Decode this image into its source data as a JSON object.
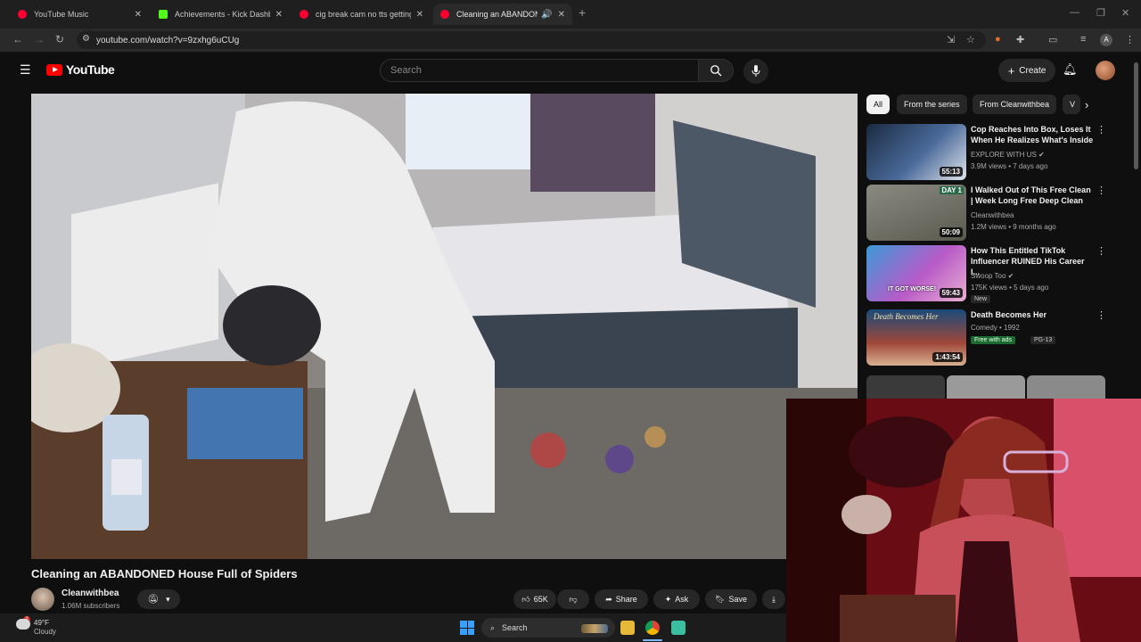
{
  "browser": {
    "tabs": [
      {
        "title": "YouTube Music",
        "active": false,
        "favicon_color": "#ff0033"
      },
      {
        "title": "Achievements - Kick Dashboard",
        "active": false,
        "favicon_color": "#53fc18"
      },
      {
        "title": "cig break cam no tts getting Ja",
        "active": false,
        "favicon_color": "#ff0033"
      },
      {
        "title": "Cleaning an ABANDONED H",
        "active": true,
        "favicon_color": "#ff0033"
      }
    ],
    "url": "youtube.com/watch?v=9zxhg6uCUg"
  },
  "youtube": {
    "logo_text": "YouTube",
    "search_placeholder": "Search",
    "create_label": "Create",
    "chips": [
      "All",
      "From the series",
      "From Cleanwithbea",
      "V"
    ],
    "recommendations": [
      {
        "title": "Cop Reaches Into Box, Loses It When He Realizes What's Inside",
        "channel": "EXPLORE WITH US",
        "verified": true,
        "meta": "3.9M views • 7 days ago",
        "duration": "55:13",
        "thumb_color": "#2a3a55"
      },
      {
        "title": "I Walked Out of This Free Clean | Week Long Free Deep Clean",
        "channel": "Cleanwithbea",
        "verified": false,
        "meta": "1.2M views • 9 months ago",
        "duration": "50:09",
        "thumb_label": "DAY 1",
        "thumb_color": "#6a6a60"
      },
      {
        "title": "How This Entitled TikTok Influencer RUINED His Career I...",
        "channel": "Swoop Too",
        "verified": true,
        "meta": "175K views • 5 days ago",
        "badge": "New",
        "duration": "59:43",
        "thumb_label": "IT GOT WORSE!",
        "thumb_color": "#7a4a8a"
      },
      {
        "title": "Death Becomes Her",
        "channel": "Comedy • 1992",
        "verified": false,
        "meta": "",
        "free_badge": "Free with ads",
        "rating": "PG-13",
        "duration": "1:43:54",
        "thumb_label": "Death Becomes Her",
        "thumb_color": "#1c3a5a"
      }
    ]
  },
  "video": {
    "title": "Cleaning an ABANDONED House Full of Spiders",
    "channel": "Cleanwithbea",
    "subscribers": "1.06M subscribers",
    "likes": "65K",
    "share_label": "Share",
    "ask_label": "Ask",
    "save_label": "Save"
  },
  "taskbar": {
    "temperature": "49°F",
    "weather": "Cloudy",
    "search_label": "Search"
  }
}
